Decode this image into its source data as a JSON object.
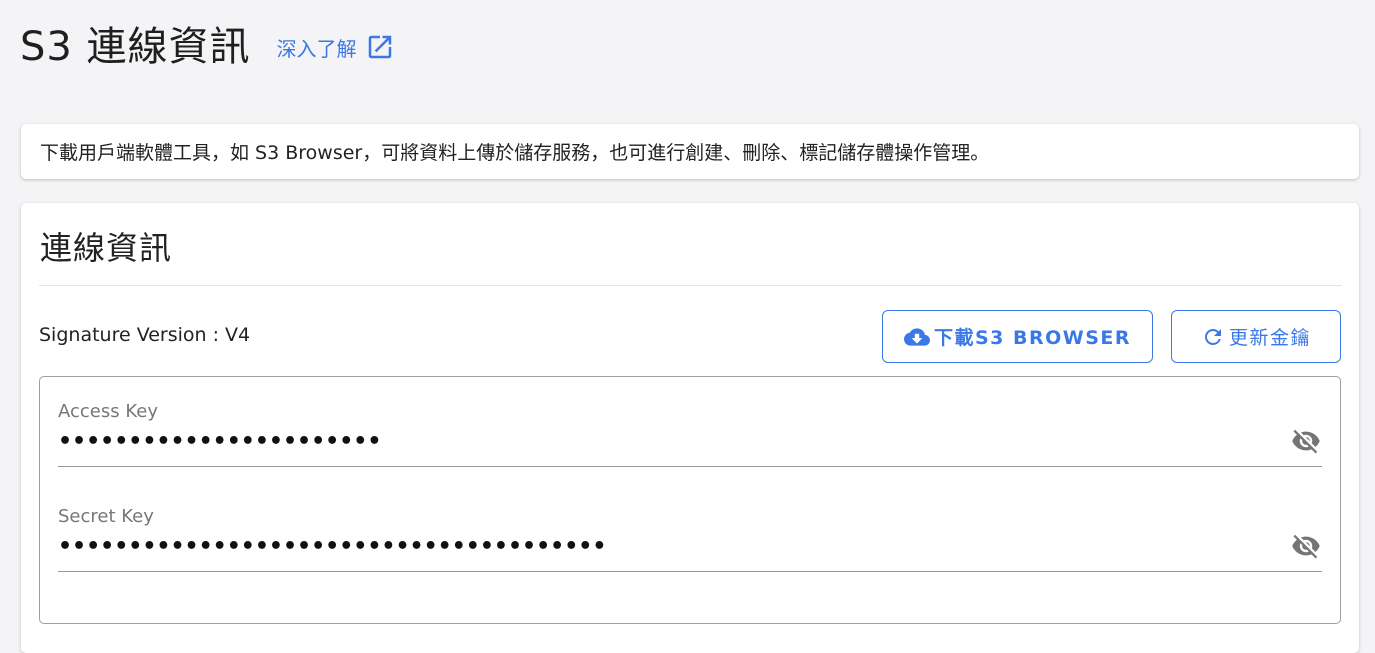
{
  "header": {
    "title": "S3 連線資訊",
    "learn_more_label": "深入了解",
    "learn_more_icon": "open-in-new-icon"
  },
  "banner": {
    "text": "下載用戶端軟體工具，如 S3 Browser，可將資料上傳於儲存服務，也可進行創建、刪除、標記儲存體操作管理。"
  },
  "card": {
    "title": "連線資訊",
    "signature_version": "Signature Version : V4",
    "buttons": {
      "download_label": "下載S3 BROWSER",
      "download_icon": "cloud-download-icon",
      "refresh_label": "更新金鑰",
      "refresh_icon": "refresh-icon"
    },
    "fields": {
      "access_key": {
        "label": "Access Key",
        "value": "•••••••••••••••••••••••",
        "toggle_icon": "eye-off-icon"
      },
      "secret_key": {
        "label": "Secret Key",
        "value": "•••••••••••••••••••••••••••••••••••••••",
        "toggle_icon": "eye-off-icon"
      }
    }
  },
  "colors": {
    "accent": "#3b78e7",
    "background": "#f4f4f6",
    "icon_gray": "#757575"
  }
}
